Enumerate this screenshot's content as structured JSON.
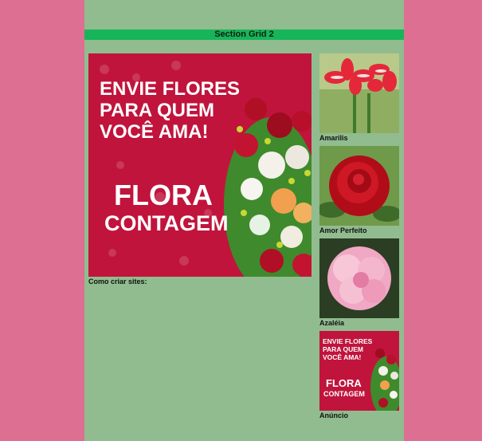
{
  "header": {
    "title": "Section Grid 2"
  },
  "main": {
    "banner": {
      "line1": "ENVIE FLORES",
      "line2": "PARA QUEM",
      "line3": "VOCÊ AMA!",
      "brand1": "FLORA",
      "brand2": "CONTAGEM"
    },
    "caption": "Como criar sites:"
  },
  "sidebar": {
    "items": [
      {
        "caption": "Amarilis"
      },
      {
        "caption": "Amor Perfeito"
      },
      {
        "caption": "Azaléia"
      },
      {
        "caption": "Anúncio",
        "banner": {
          "line1": "ENVIE FLORES",
          "line2": "PARA QUEM",
          "line3": "VOCÊ AMA!",
          "brand1": "FLORA",
          "brand2": "CONTAGEM"
        }
      }
    ]
  },
  "colors": {
    "outer": "#dd6f92",
    "content": "#91bc8f",
    "bar": "#16b559",
    "banner": "#c0143c"
  }
}
